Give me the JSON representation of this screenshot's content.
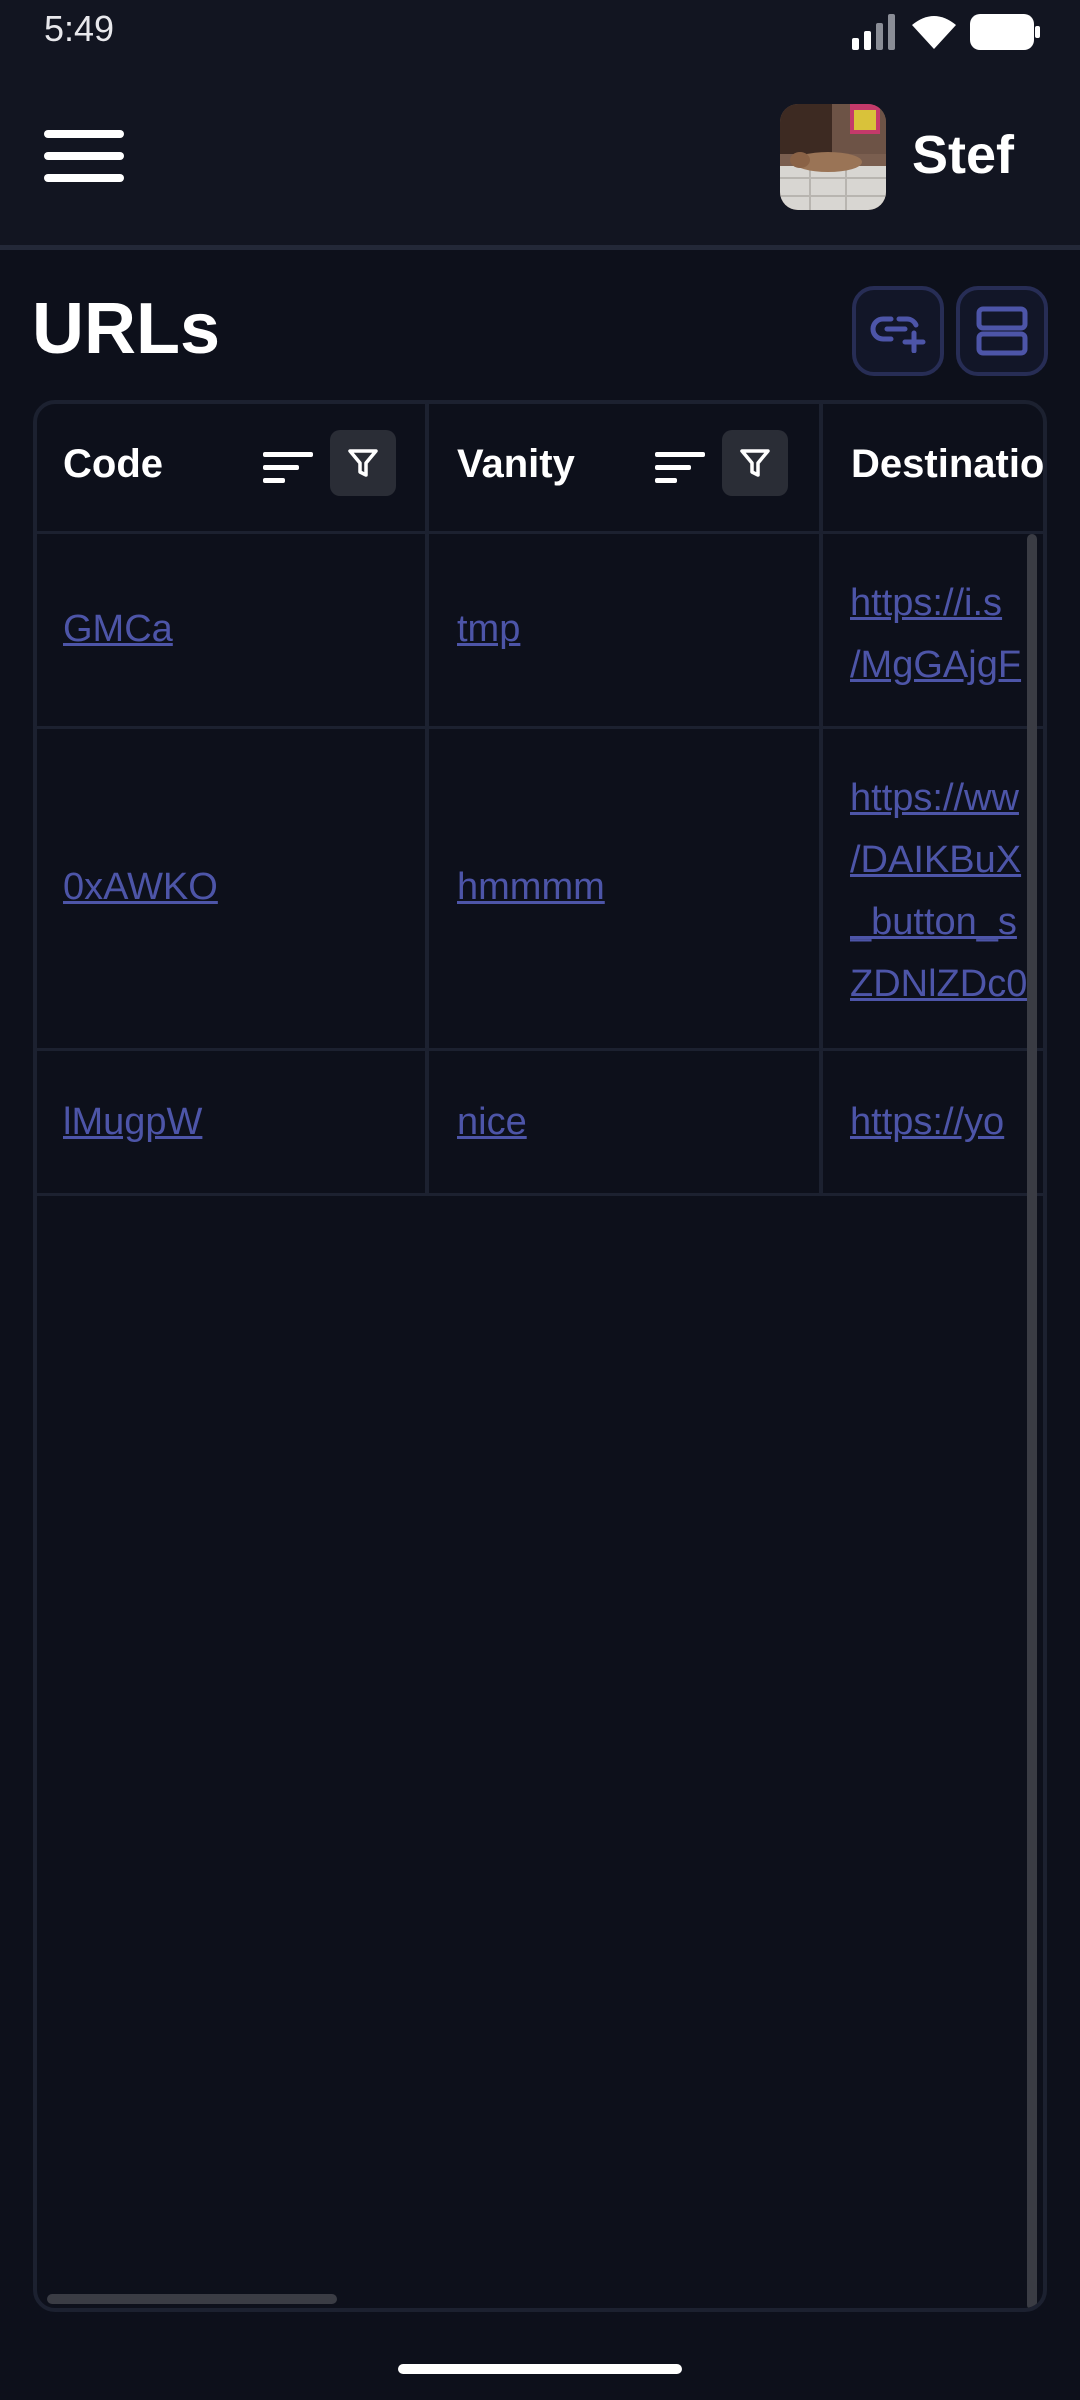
{
  "status_bar": {
    "time": "5:49"
  },
  "header": {
    "user_name": "Stef"
  },
  "page": {
    "title": "URLs"
  },
  "table": {
    "columns": [
      {
        "label": "Code"
      },
      {
        "label": "Vanity"
      },
      {
        "label": "Destinatio"
      }
    ],
    "rows": [
      {
        "code": "GMCa",
        "vanity": "tmp",
        "destination": [
          "https://i.s",
          "/MgGAjgF"
        ]
      },
      {
        "code": "0xAWKO",
        "vanity": "hmmmm",
        "destination": [
          "https://ww",
          "/DAIKBuX",
          "_button_s",
          "ZDNlZDc0"
        ]
      },
      {
        "code": "lMugpW",
        "vanity": "nice",
        "destination": [
          "https://yo"
        ]
      }
    ]
  },
  "colors": {
    "background": "#0d101b",
    "appbar": "#121521",
    "link": "#4d55a8",
    "border": "#1c2130"
  },
  "icons": [
    "signal-icon",
    "wifi-icon",
    "battery-icon",
    "menu-icon",
    "link-add-icon",
    "view-icon",
    "sort-icon",
    "filter-icon"
  ]
}
